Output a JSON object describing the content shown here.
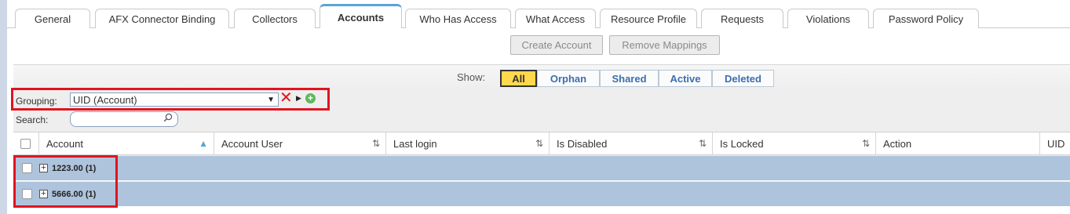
{
  "tabs": [
    {
      "label": "General",
      "active": false
    },
    {
      "label": "AFX Connector Binding",
      "active": false
    },
    {
      "label": "Collectors",
      "active": false
    },
    {
      "label": "Accounts",
      "active": true
    },
    {
      "label": "Who Has Access",
      "active": false
    },
    {
      "label": "What Access",
      "active": false
    },
    {
      "label": "Resource Profile",
      "active": false
    },
    {
      "label": "Requests",
      "active": false
    },
    {
      "label": "Violations",
      "active": false
    },
    {
      "label": "Password Policy",
      "active": false
    }
  ],
  "actions": {
    "create_account": "Create Account",
    "remove_mappings": "Remove Mappings"
  },
  "show": {
    "label": "Show:",
    "filters": [
      "All",
      "Orphan",
      "Shared",
      "Active",
      "Deleted"
    ],
    "selected": "All"
  },
  "grouping": {
    "label": "Grouping:",
    "value": "UID (Account)"
  },
  "search": {
    "label": "Search:",
    "value": ""
  },
  "table": {
    "columns": [
      "Account",
      "Account User",
      "Last login",
      "Is Disabled",
      "Is Locked",
      "Action",
      "UID"
    ],
    "groups": [
      {
        "label": "1223.00 (1)"
      },
      {
        "label": "5666.00 (1)"
      }
    ]
  },
  "colors": {
    "active_tab_accent": "#5ba3d6",
    "selected_filter": "#ffd84d",
    "highlight_box": "#e0141e",
    "group_row": "#aec3dc"
  }
}
